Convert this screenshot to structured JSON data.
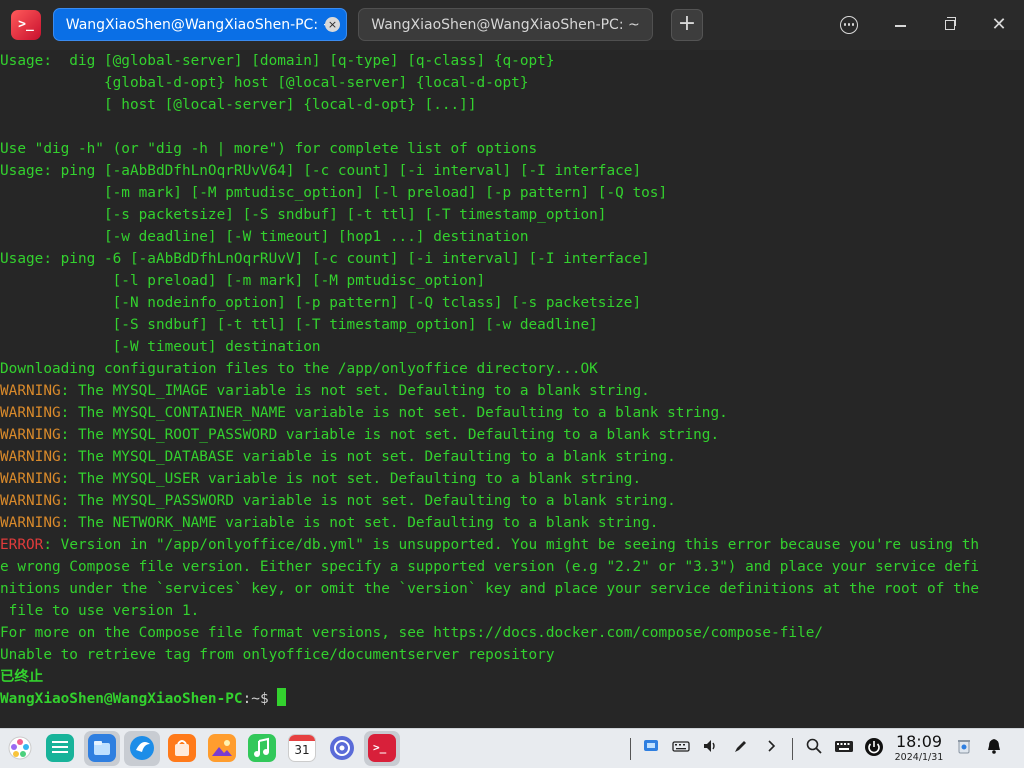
{
  "titlebar": {
    "tabs": [
      {
        "label": "WangXiaoShen@WangXiaoShen-PC: ~",
        "active": true
      },
      {
        "label": "WangXiaoShen@WangXiaoShen-PC: ~",
        "active": false
      }
    ],
    "new_tab_label": "+",
    "close_tab_glyph": "×",
    "icons": [
      "terminal-app-icon",
      "menu-icon",
      "minimize-icon",
      "maximize-icon",
      "close-icon"
    ]
  },
  "terminal": {
    "lines": [
      {
        "text": "Usage:  dig [@global-server] [domain] [q-type] [q-class] {q-opt}"
      },
      {
        "text": "            {global-d-opt} host [@local-server] {local-d-opt}"
      },
      {
        "text": "            [ host [@local-server] {local-d-opt} [...]]"
      },
      {
        "text": ""
      },
      {
        "text": "Use \"dig -h\" (or \"dig -h | more\") for complete list of options"
      },
      {
        "text": "Usage: ping [-aAbBdDfhLnOqrRUvV64] [-c count] [-i interval] [-I interface]"
      },
      {
        "text": "            [-m mark] [-M pmtudisc_option] [-l preload] [-p pattern] [-Q tos]"
      },
      {
        "text": "            [-s packetsize] [-S sndbuf] [-t ttl] [-T timestamp_option]"
      },
      {
        "text": "            [-w deadline] [-W timeout] [hop1 ...] destination"
      },
      {
        "text": "Usage: ping -6 [-aAbBdDfhLnOqrRUvV] [-c count] [-i interval] [-I interface]"
      },
      {
        "text": "             [-l preload] [-m mark] [-M pmtudisc_option]"
      },
      {
        "text": "             [-N nodeinfo_option] [-p pattern] [-Q tclass] [-s packetsize]"
      },
      {
        "text": "             [-S sndbuf] [-t ttl] [-T timestamp_option] [-w deadline]"
      },
      {
        "text": "             [-W timeout] destination"
      },
      {
        "text": "Downloading configuration files to the /app/onlyoffice directory...OK"
      },
      {
        "prefix": "WARNING",
        "prefix_type": "warn",
        "text": ": The MYSQL_IMAGE variable is not set. Defaulting to a blank string."
      },
      {
        "prefix": "WARNING",
        "prefix_type": "warn",
        "text": ": The MYSQL_CONTAINER_NAME variable is not set. Defaulting to a blank string."
      },
      {
        "prefix": "WARNING",
        "prefix_type": "warn",
        "text": ": The MYSQL_ROOT_PASSWORD variable is not set. Defaulting to a blank string."
      },
      {
        "prefix": "WARNING",
        "prefix_type": "warn",
        "text": ": The MYSQL_DATABASE variable is not set. Defaulting to a blank string."
      },
      {
        "prefix": "WARNING",
        "prefix_type": "warn",
        "text": ": The MYSQL_USER variable is not set. Defaulting to a blank string."
      },
      {
        "prefix": "WARNING",
        "prefix_type": "warn",
        "text": ": The MYSQL_PASSWORD variable is not set. Defaulting to a blank string."
      },
      {
        "prefix": "WARNING",
        "prefix_type": "warn",
        "text": ": The NETWORK_NAME variable is not set. Defaulting to a blank string."
      },
      {
        "prefix": "ERROR",
        "prefix_type": "err",
        "text": ": Version in \"/app/onlyoffice/db.yml\" is unsupported. You might be seeing this error because you're using th"
      },
      {
        "text": "e wrong Compose file version. Either specify a supported version (e.g \"2.2\" or \"3.3\") and place your service defi"
      },
      {
        "text": "nitions under the `services` key, or omit the `version` key and place your service definitions at the root of the"
      },
      {
        "text": " file to use version 1."
      },
      {
        "text": "For more on the Compose file format versions, see https://docs.docker.com/compose/compose-file/"
      },
      {
        "text": "Unable to retrieve tag from onlyoffice/documentserver repository"
      },
      {
        "text": "已终止",
        "bold": true
      }
    ],
    "prompt": {
      "user": "WangXiaoShen@WangXiaoShen-PC",
      "sep": ":",
      "path": "~",
      "symbol": "$ "
    }
  },
  "taskbar": {
    "apps": [
      "launcher-icon",
      "desktop-icon",
      "file-manager-icon",
      "browser-icon",
      "app-store-icon",
      "image-viewer-icon",
      "music-icon",
      "calendar-icon",
      "settings-icon",
      "terminal-icon"
    ],
    "calendar_day": "31",
    "tray": [
      "screenshot-icon",
      "keyboard-icon",
      "volume-icon",
      "pen-icon",
      "chevron-right-icon",
      "search-icon",
      "input-method-icon",
      "power-icon"
    ],
    "time": "18:09",
    "date": "2024/1/31",
    "tray_right": [
      "trash-icon",
      "notification-bell-icon"
    ]
  },
  "colors": {
    "terminal_fg": "#33d12e",
    "warning": "#d98a2b",
    "error": "#e03b3b",
    "tab_active": "#0a6fe6",
    "terminal_bg": "#262626"
  }
}
